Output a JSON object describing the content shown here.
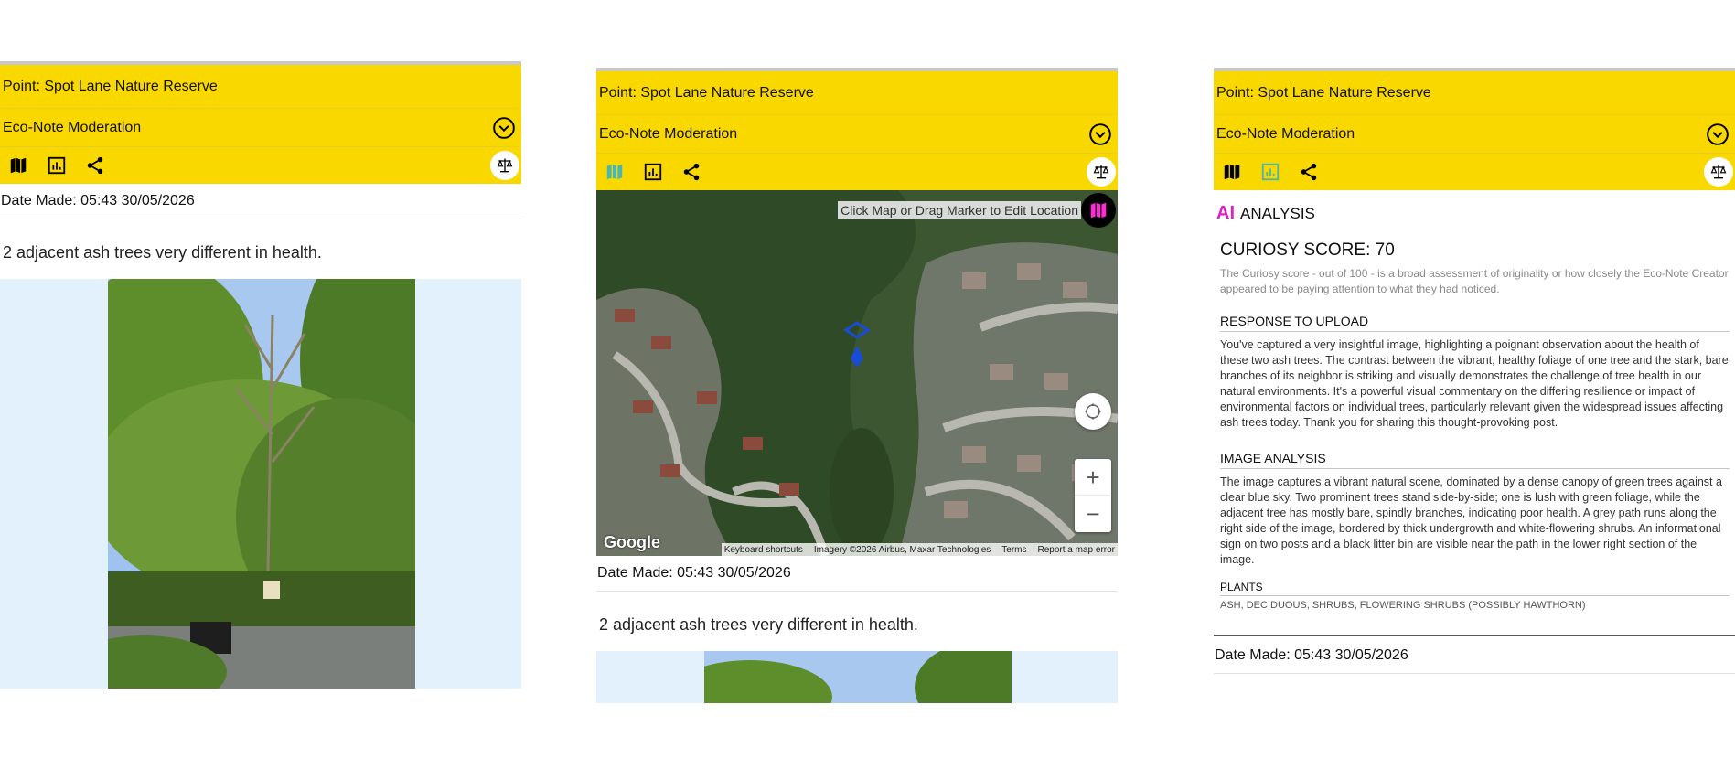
{
  "point_title": "Point: Spot Lane Nature Reserve",
  "moderation_label": "Eco-Note Moderation",
  "date_made": "Date Made: 05:43 30/05/2026",
  "caption": "2 adjacent ash trees very different in health.",
  "icons": {
    "map": "map-icon",
    "analytics": "analytics-icon",
    "share": "share-icon",
    "scale": "balance-scale-icon",
    "chevron": "chevron-down-circle-icon",
    "marker": "map-marker-icon",
    "fullscreen": "fullscreen-icon",
    "zoom_in": "zoom-in-icon",
    "zoom_out": "zoom-out-icon"
  },
  "colors": {
    "header_yellow": "#f9d800",
    "active_tool": "#4db6ac",
    "ai_badge": "#e020c0",
    "photo_bg": "#e3f1fd"
  },
  "map": {
    "hint": "Click Map or Drag Marker to Edit Location",
    "zoom_in": "+",
    "zoom_out": "−",
    "logo": "Google",
    "footer": {
      "shortcuts": "Keyboard shortcuts",
      "imagery": "Imagery ©2026 Airbus, Maxar Technologies",
      "terms": "Terms",
      "report": "Report a map error"
    }
  },
  "analysis": {
    "badge": "AI",
    "title": "ANALYSIS",
    "score": "CURIOSY SCORE: 70",
    "score_note": "The Curiosy score - out of 100 - is a broad assessment of originality or how closely the Eco-Note Creator appeared to be paying attention to what they had noticed.",
    "response_heading": "RESPONSE TO UPLOAD",
    "response_body": "You've captured a very insightful image, highlighting a poignant observation about the health of these two ash trees. The contrast between the vibrant, healthy foliage of one tree and the stark, bare branches of its neighbor is striking and visually demonstrates the challenge of tree health in our natural environments. It's a powerful visual commentary on the differing resilience or impact of environmental factors on individual trees, particularly relevant given the widespread issues affecting ash trees today. Thank you for sharing this thought-provoking post.",
    "image_heading": "IMAGE ANALYSIS",
    "image_body": "The image captures a vibrant natural scene, dominated by a dense canopy of green trees against a clear blue sky. Two prominent trees stand side-by-side; one is lush with green foliage, while the adjacent tree has mostly bare, spindly branches, indicating poor health. A grey path runs along the right side of the image, bordered by thick undergrowth and white-flowering shrubs. An informational sign on two posts and a black litter bin are visible near the path in the lower right section of the image.",
    "plants_heading": "PLANTS",
    "plants_body": "ASH, DECIDUOUS, SHRUBS, FLOWERING SHRUBS (POSSIBLY HAWTHORN)"
  }
}
